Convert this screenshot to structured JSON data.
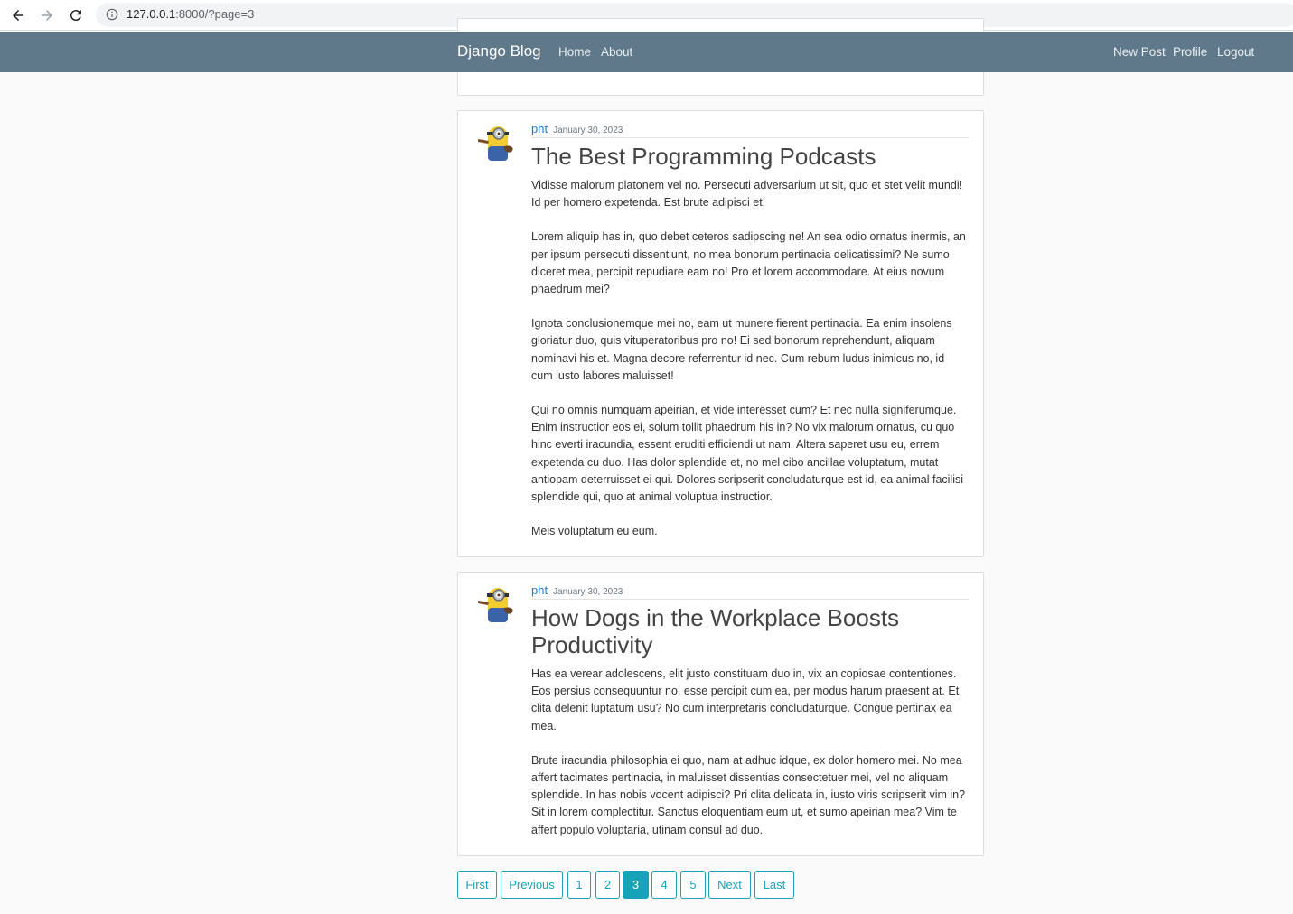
{
  "browser": {
    "url_host": "127.0.0.1",
    "url_rest": ":8000/?page=3"
  },
  "navbar": {
    "brand": "Django Blog",
    "left_links": [
      "Home",
      "About"
    ],
    "right_links": [
      "New Post",
      "Profile",
      "Logout"
    ]
  },
  "posts": [
    {
      "author": "pht",
      "date": "January 30, 2023",
      "title": "The Best Programming Podcasts",
      "paragraphs": [
        "Vidisse malorum platonem vel no. Persecuti adversarium ut sit, quo et stet velit mundi! Id per homero expetenda. Est brute adipisci et!",
        "Lorem aliquip has in, quo debet ceteros sadipscing ne! An sea odio ornatus inermis, an per ipsum persecuti dissentiunt, no mea bonorum pertinacia delicatissimi? Ne sumo diceret mea, percipit repudiare eam no! Pro et lorem accommodare. At eius novum phaedrum mei?",
        "Ignota conclusionemque mei no, eam ut munere fierent pertinacia. Ea enim insolens gloriatur duo, quis vituperatoribus pro no! Ei sed bonorum reprehendunt, aliquam nominavi his et. Magna decore referrentur id nec. Cum rebum ludus inimicus no, id cum iusto labores maluisset!",
        "Qui no omnis numquam apeirian, et vide interesset cum? Et nec nulla signiferumque. Enim instructior eos ei, solum tollit phaedrum his in? No vix malorum ornatus, cu quo hinc everti iracundia, essent eruditi efficiendi ut nam. Altera saperet usu eu, errem expetenda cu duo. Has dolor splendide et, no mel cibo ancillae voluptatum, mutat antiopam deterruisset ei qui. Dolores scripserit concludaturque est id, ea animal facilisi splendide qui, quo at animal voluptua instructior.",
        "Meis voluptatum eu eum."
      ]
    },
    {
      "author": "pht",
      "date": "January 30, 2023",
      "title": "How Dogs in the Workplace Boosts Productivity",
      "paragraphs": [
        "Has ea verear adolescens, elit justo constituam duo in, vix an copiosae contentiones. Eos persius consequuntur no, esse percipit cum ea, per modus harum praesent at. Et clita delenit luptatum usu? No cum interpretaris concludaturque. Congue pertinax ea mea.",
        "Brute iracundia philosophia ei quo, nam at adhuc idque, ex dolor homero mei. No mea affert tacimates pertinacia, in maluisset dissentias consectetuer mei, vel no aliquam splendide. In has nobis vocent adipisci? Pri clita delicata in, iusto viris scripserit vim in? Sit in lorem complectitur. Sanctus eloquentiam eum ut, et sumo apeirian mea? Vim te affert populo voluptaria, utinam consul ad duo."
      ]
    }
  ],
  "pagination": {
    "buttons": [
      "First",
      "Previous",
      "1",
      "2",
      "3",
      "4",
      "5",
      "Next",
      "Last"
    ],
    "active": "3"
  }
}
